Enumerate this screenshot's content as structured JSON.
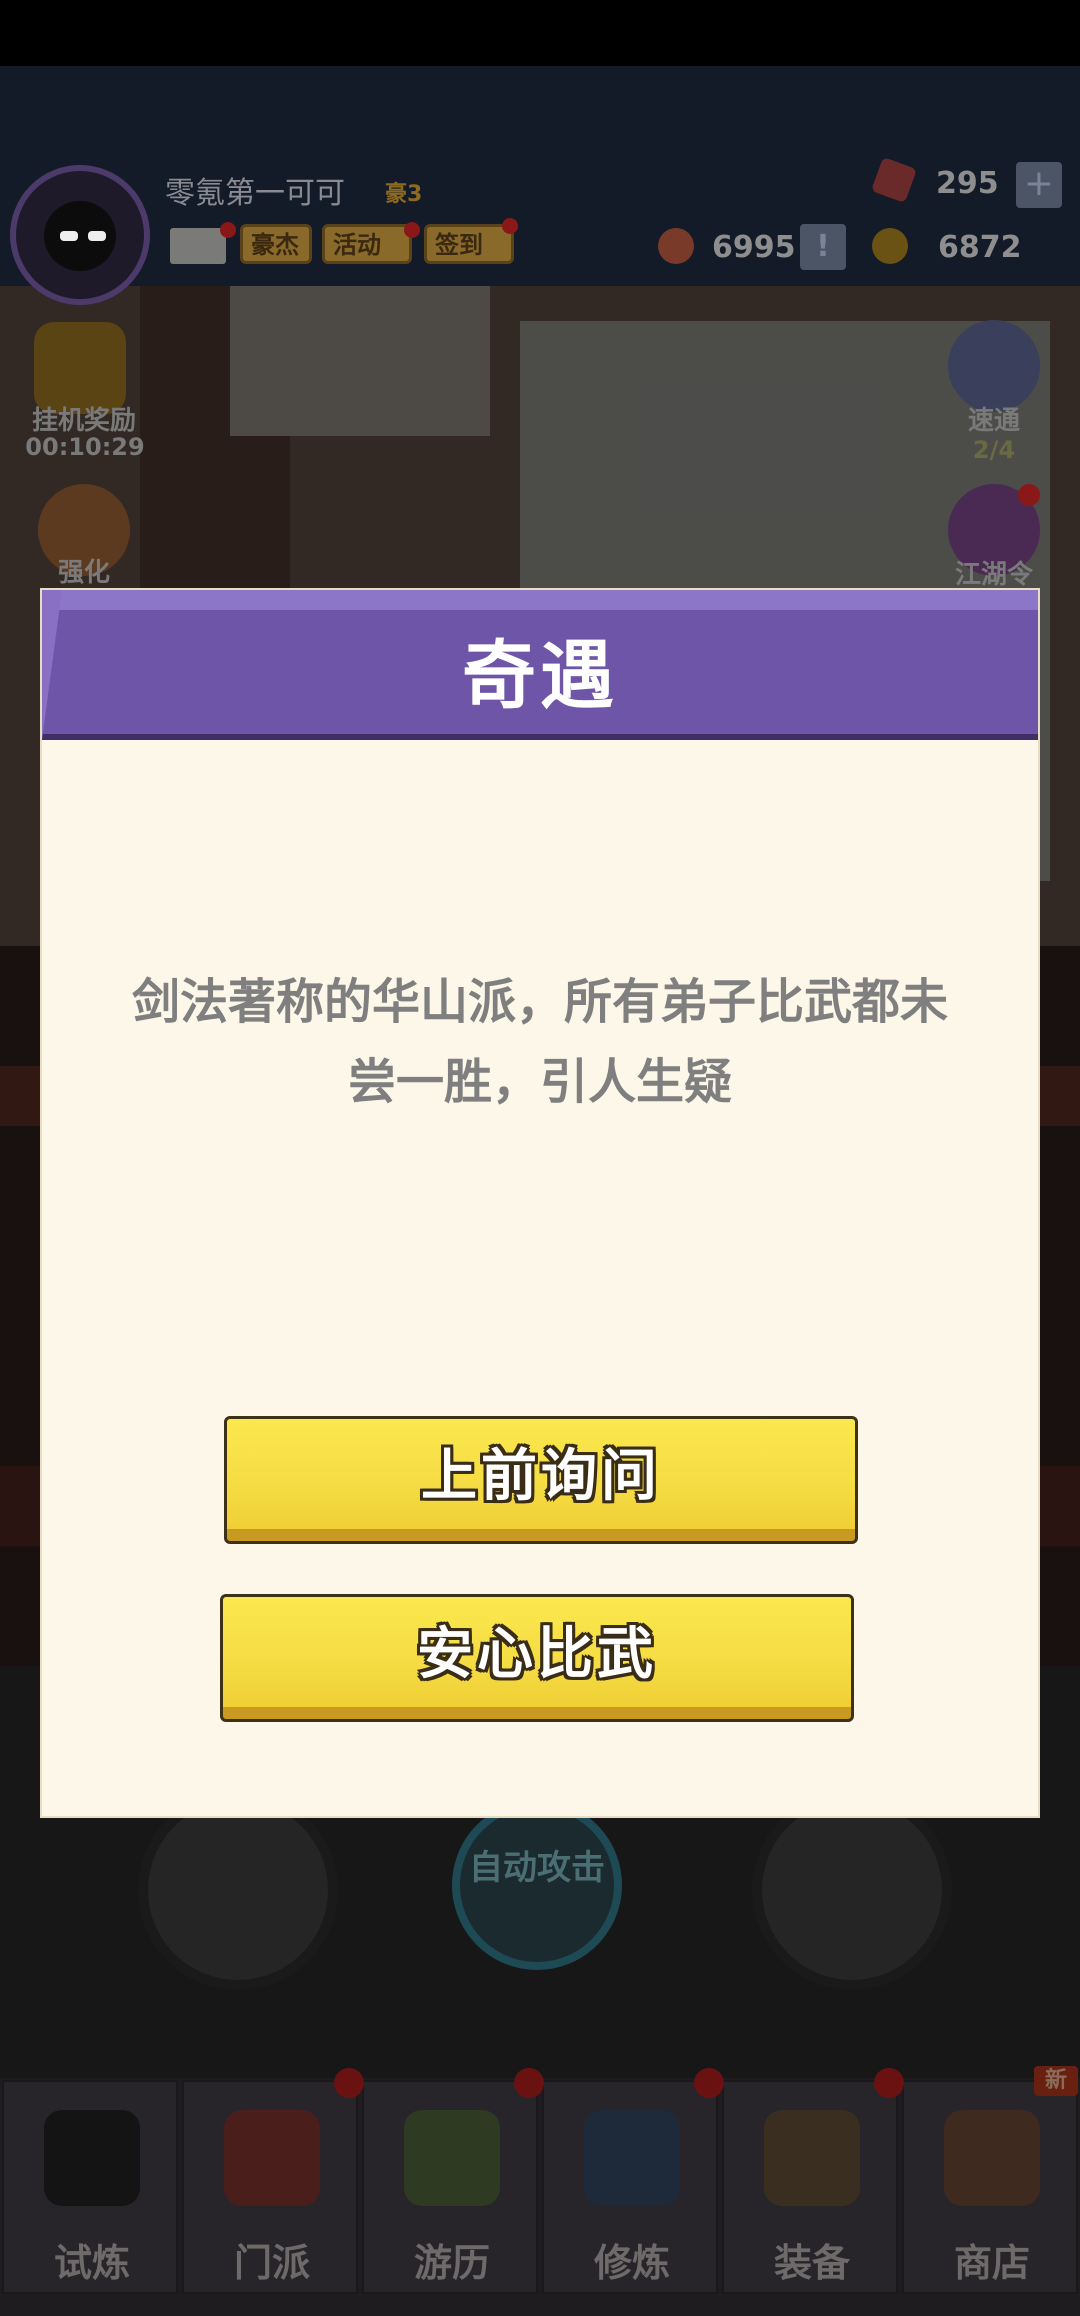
{
  "header": {
    "player_name": "零氪第一可可",
    "player_rank": "豪3",
    "buttons": [
      "豪杰",
      "活动",
      "签到"
    ],
    "gems": "295",
    "tokens": "6995",
    "coins": "6872"
  },
  "side": {
    "idle_reward_label": "挂机奖励",
    "idle_reward_timer": "00:10:29",
    "strengthen_label": "强化",
    "speed_label": "速通",
    "speed_progress": "2/4",
    "jianghu_label": "江湖令"
  },
  "controls": {
    "auto_attack_label": "自动攻击"
  },
  "modal": {
    "title": "奇遇",
    "text": "剑法著称的华山派，所有弟子比武都未尝一胜，引人生疑",
    "choices": [
      "上前询问",
      "安心比武"
    ]
  },
  "nav": {
    "items": [
      "试炼",
      "门派",
      "游历",
      "修炼",
      "装备",
      "商店"
    ],
    "new_badge": "新"
  },
  "colors": {
    "modal_header": "#6e55a8",
    "modal_body": "#fdf7e9",
    "button_yellow": "#f5dc43"
  }
}
